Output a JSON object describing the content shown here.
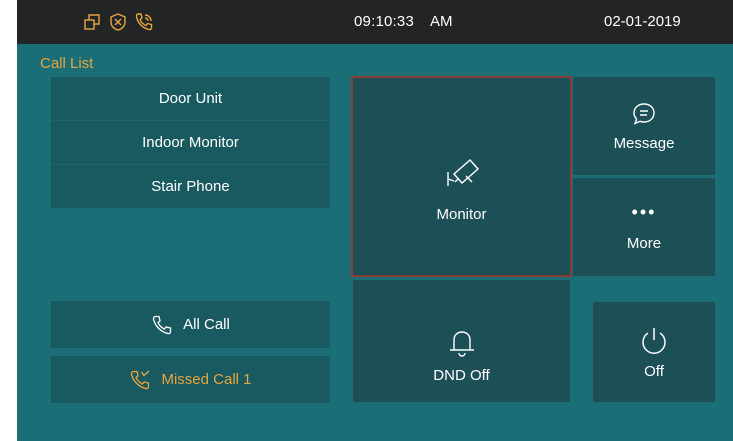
{
  "status": {
    "time": "09:10:33",
    "ampm": "AM",
    "date": "02-01-2019",
    "icons": [
      "window-icon",
      "shield-x-icon",
      "phone-call-icon"
    ]
  },
  "call_list": {
    "title": "Call List",
    "items": [
      {
        "label": "Door Unit"
      },
      {
        "label": "Indoor Monitor"
      },
      {
        "label": "Stair Phone"
      }
    ]
  },
  "calls": {
    "all_label": "All Call",
    "missed_label": "Missed Call 1"
  },
  "tiles": {
    "monitor": "Monitor",
    "message": "Message",
    "more": "More",
    "more_dots": "•••",
    "dnd": "DND Off",
    "power": "Off"
  },
  "colors": {
    "background": "#1b6d76",
    "statusbar": "#222425",
    "tile": "#1d4f56",
    "accent": "#e8a53f",
    "selected_border": "#8a3a37"
  }
}
